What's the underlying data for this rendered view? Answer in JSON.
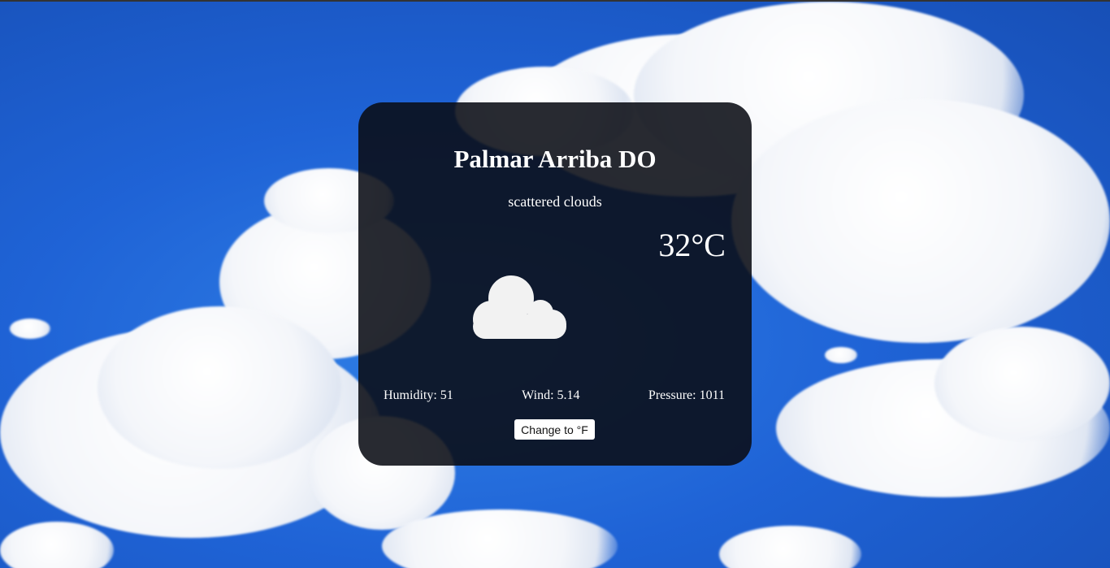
{
  "location": {
    "city": "Palmar Arriba DO"
  },
  "weather": {
    "description": "scattered clouds",
    "temperature": "32°C",
    "icon": "cloud-icon"
  },
  "stats": {
    "humidity": "Humidity: 51",
    "wind": "Wind: 5.14",
    "pressure": "Pressure: 1011"
  },
  "controls": {
    "unit_toggle_label": "Change to °F"
  },
  "colors": {
    "card_background": "#0a0c14",
    "sky_blue": "#1f63d6",
    "text": "#ffffff",
    "icon_fill": "#f2f2f2"
  }
}
